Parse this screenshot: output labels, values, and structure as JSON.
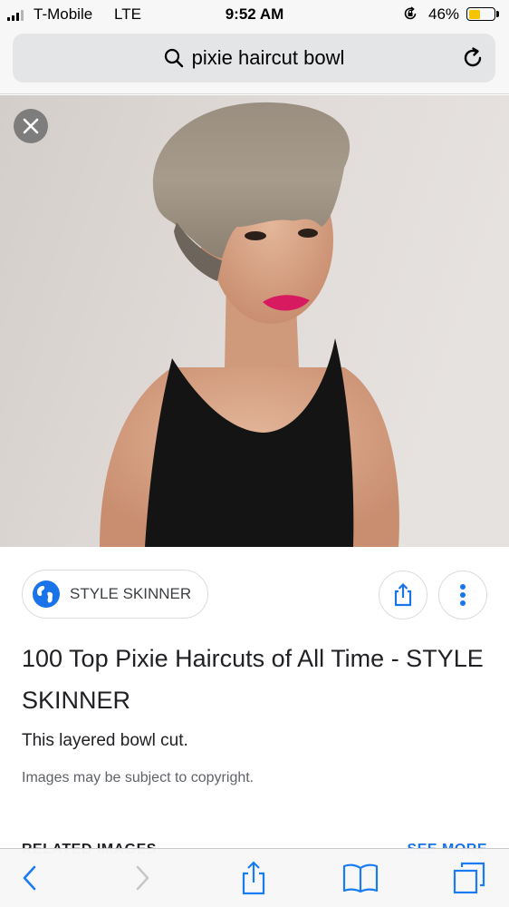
{
  "status_bar": {
    "carrier": "T-Mobile",
    "network": "LTE",
    "time": "9:52 AM",
    "battery_percent": "46%",
    "battery_level": 0.46,
    "signal_bars": 3,
    "icons": [
      "signal-icon",
      "orientation-lock-icon",
      "battery-icon"
    ]
  },
  "address_bar": {
    "query": "pixie haircut bowl",
    "icons": [
      "search-icon",
      "reload-icon"
    ]
  },
  "image_viewer": {
    "icons": [
      "close-icon"
    ]
  },
  "result": {
    "source": "STYLE SKINNER",
    "title": "100 Top Pixie Haircuts of All Time - STYLE SKINNER",
    "description": "This layered bowl cut.",
    "copyright_notice": "Images may be subject to copyright.",
    "icons": [
      "globe-icon",
      "share-icon",
      "more-vert-icon"
    ]
  },
  "related": {
    "label": "RELATED IMAGES",
    "see_more": "SEE MORE"
  },
  "toolbar": {
    "icons": [
      "back-icon",
      "forward-icon",
      "share-icon",
      "bookmarks-icon",
      "tabs-icon"
    ]
  },
  "colors": {
    "accent_blue": "#1a73e8",
    "ios_blue": "#1a7cf5",
    "battery_fill": "#f5c400",
    "lipstick": "#d81b60"
  }
}
